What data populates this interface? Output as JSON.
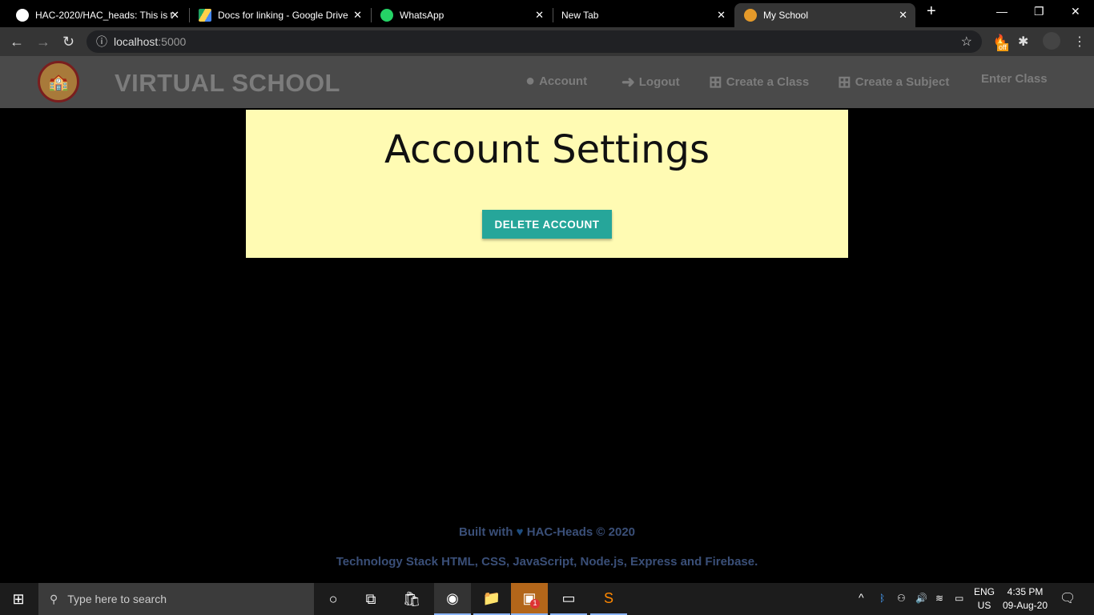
{
  "browser": {
    "tabs": [
      {
        "title": "HAC-2020/HAC_heads: This is t",
        "icon": "github-icon"
      },
      {
        "title": "Docs for linking - Google Drive",
        "icon": "google-drive-icon"
      },
      {
        "title": "WhatsApp",
        "icon": "whatsapp-icon"
      },
      {
        "title": "New Tab",
        "icon": ""
      },
      {
        "title": "My School",
        "icon": "school-icon",
        "active": true
      }
    ],
    "url_host": "localhost",
    "url_port": ":5000",
    "extension_badge": "off"
  },
  "header": {
    "brand": "VIRTUAL SCHOOL",
    "menu": [
      {
        "label": "Account",
        "icon": "user-circle-icon"
      },
      {
        "label": "Logout",
        "icon": "sign-out-icon"
      },
      {
        "label": "Create a Class",
        "icon": "plus-square-icon"
      },
      {
        "label": "Create a Subject",
        "icon": "plus-square-icon"
      },
      {
        "label": "Enter Class",
        "icon": ""
      }
    ]
  },
  "main": {
    "title": "Account Settings",
    "delete_label": "DELETE ACCOUNT",
    "accent": "#26a69a",
    "card_bg": "#fffbb3"
  },
  "footer": {
    "built_prefix": "Built with",
    "heart": "♥",
    "built_suffix": "HAC-Heads © 2020",
    "stack_prefix": "Technology Stack",
    "stack_items": "HTML, CSS, JavaScript, Node.js, Express and Firebase."
  },
  "taskbar": {
    "search_placeholder": "Type here to search",
    "badge": "1",
    "lang1": "ENG",
    "lang2": "US",
    "time": "4:35 PM",
    "date": "09-Aug-20"
  }
}
